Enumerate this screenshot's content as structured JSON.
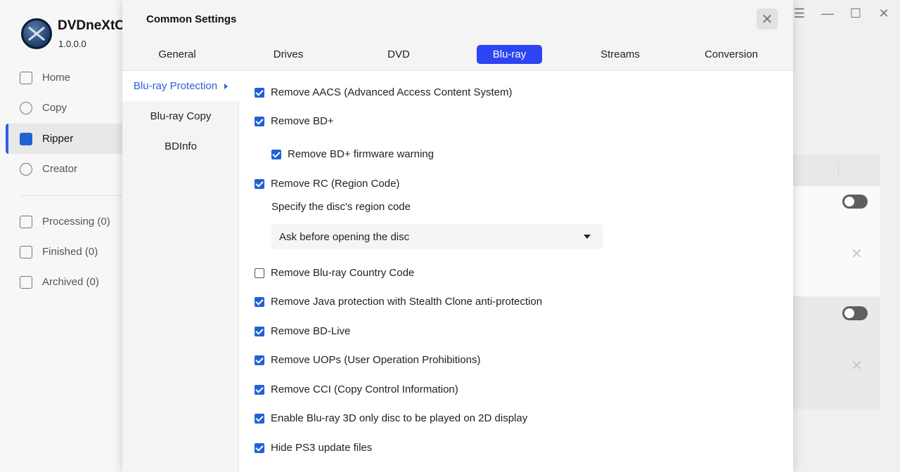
{
  "app": {
    "name": "DVDneXtC",
    "version": "1.0.0.0"
  },
  "nav": [
    {
      "label": "Home",
      "icon": "home-icon"
    },
    {
      "label": "Copy",
      "icon": "copy-icon"
    },
    {
      "label": "Ripper",
      "icon": "ripper-icon",
      "active": true
    },
    {
      "label": "Creator",
      "icon": "creator-icon"
    },
    {
      "label": "Processing (0)",
      "icon": "processing-icon"
    },
    {
      "label": "Finished (0)",
      "icon": "finished-icon"
    },
    {
      "label": "Archived (0)",
      "icon": "archived-icon"
    }
  ],
  "window": {
    "menu_glyph": "☰",
    "minimize_glyph": "—",
    "maximize_glyph": "☐",
    "close_glyph": "✕"
  },
  "dialog": {
    "title": "Common Settings",
    "close_glyph": "✕",
    "tabs": [
      "General",
      "Drives",
      "DVD",
      "Blu-ray",
      "Streams",
      "Conversion"
    ],
    "active_tab": "Blu-ray",
    "sub_nav": [
      "Blu-ray Protection",
      "Blu-ray Copy",
      "BDInfo"
    ],
    "active_sub": "Blu-ray Protection",
    "options": [
      {
        "label": "Remove AACS (Advanced Access Content System)",
        "checked": true
      },
      {
        "label": "Remove BD+",
        "checked": true
      },
      {
        "label": "Remove BD+ firmware warning",
        "checked": true
      },
      {
        "label": "Remove RC (Region Code)",
        "checked": true
      },
      {
        "label": "Remove Blu-ray Country Code",
        "checked": false
      },
      {
        "label": "Remove Java protection with Stealth Clone anti-protection",
        "checked": true
      },
      {
        "label": "Remove BD-Live",
        "checked": true
      },
      {
        "label": "Remove UOPs (User Operation Prohibitions)",
        "checked": true
      },
      {
        "label": "Remove CCI (Copy Control Information)",
        "checked": true
      },
      {
        "label": "Enable Blu-ray 3D only disc to be played on 2D display",
        "checked": true
      },
      {
        "label": "Hide PS3 update files",
        "checked": true
      }
    ],
    "region_label": "Specify the disc's region code",
    "region_value": "Ask before opening the disc"
  },
  "colors": {
    "accent": "#2d44f2",
    "checkbox": "#1f62d6",
    "link": "#2b5fd9"
  }
}
